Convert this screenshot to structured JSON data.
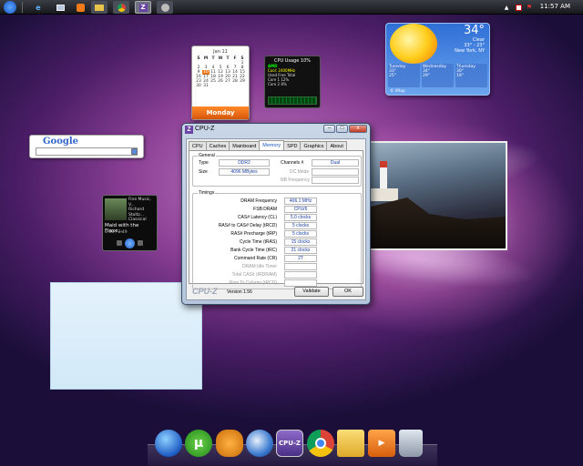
{
  "taskbar": {
    "clock": "11:57 AM"
  },
  "calendar": {
    "month": "Jan 11",
    "weekday_headers": [
      "S",
      "M",
      "T",
      "W",
      "T",
      "F",
      "S"
    ],
    "days": [
      "",
      "",
      "",
      "",
      "",
      "",
      "1",
      "2",
      "3",
      "4",
      "5",
      "6",
      "7",
      "8",
      "9",
      "10",
      "11",
      "12",
      "13",
      "14",
      "15",
      "16",
      "17",
      "18",
      "19",
      "20",
      "21",
      "22",
      "23",
      "24",
      "25",
      "26",
      "27",
      "28",
      "29",
      "30",
      "31"
    ],
    "today": "10",
    "footer": "Monday"
  },
  "cpu_gadget": {
    "title": "CPU Usage 10%",
    "brand": "AMD",
    "rows": [
      "Cool: 2400MHz",
      "Used Free Total",
      "Core 1  12%",
      "Core 2   8%"
    ]
  },
  "weather": {
    "temperature": "34°",
    "condition": "Clear",
    "range": "33° - 23°",
    "location": "New York, NY",
    "days": [
      {
        "name": "Tuesday",
        "hi": "33°",
        "lo": "25°"
      },
      {
        "name": "Wednesday",
        "hi": "34°",
        "lo": "29°"
      },
      {
        "name": "Thursday",
        "hi": "30°",
        "lo": "19°"
      }
    ],
    "footer": "© iMap"
  },
  "google": {
    "logo": "Google"
  },
  "media": {
    "info_line1": "Fine Music, V...",
    "info_line2": "Richard Stoltz...",
    "info_line3": "Classical",
    "title": "Maid with the Flaxe...",
    "time": "0:00 / 2:49"
  },
  "cpuz": {
    "title": "CPU-Z",
    "app_icon": "Z",
    "tabs": [
      "CPU",
      "Caches",
      "Mainboard",
      "Memory",
      "SPD",
      "Graphics",
      "About"
    ],
    "active_tab": "Memory",
    "general": {
      "heading": "General",
      "type_label": "Type",
      "type_value": "DDR2",
      "size_label": "Size",
      "size_value": "4096 MBytes",
      "channels_label": "Channels #",
      "channels_value": "Dual",
      "dc_mode_label": "DC Mode",
      "dc_mode_value": "",
      "nb_freq_label": "NB Frequency",
      "nb_freq_value": ""
    },
    "timings": {
      "heading": "Timings",
      "rows": [
        {
          "label": "DRAM Frequency",
          "value": "406.1 MHz",
          "disabled": false
        },
        {
          "label": "FSB:DRAM",
          "value": "CPU/6",
          "disabled": false
        },
        {
          "label": "CAS# Latency (CL)",
          "value": "5.0 clocks",
          "disabled": false
        },
        {
          "label": "RAS# to CAS# Delay (tRCD)",
          "value": "5 clocks",
          "disabled": false
        },
        {
          "label": "RAS# Precharge (tRP)",
          "value": "5 clocks",
          "disabled": false
        },
        {
          "label": "Cycle Time (tRAS)",
          "value": "15 clocks",
          "disabled": false
        },
        {
          "label": "Bank Cycle Time (tRC)",
          "value": "21 clocks",
          "disabled": false
        },
        {
          "label": "Command Rate (CR)",
          "value": "2T",
          "disabled": false
        },
        {
          "label": "DRAM Idle Timer",
          "value": "",
          "disabled": true
        },
        {
          "label": "Total CAS# (tRDRAM)",
          "value": "",
          "disabled": true
        },
        {
          "label": "Row To Column (tRCD)",
          "value": "",
          "disabled": true
        }
      ]
    },
    "brand": "CPU-Z",
    "version": "Version 1.56",
    "validate_label": "Validate",
    "ok_label": "OK",
    "minimize": "–",
    "maximize": "□",
    "close": "x"
  },
  "dock": {
    "icons": [
      "windows-start-icon",
      "utorrent-icon",
      "fl-studio-icon",
      "thunderbird-icon",
      "cpuz-icon",
      "chrome-icon",
      "folder-icon",
      "media-player-icon",
      "recycle-bin-icon"
    ],
    "cpuz_label": "CPU-Z"
  }
}
